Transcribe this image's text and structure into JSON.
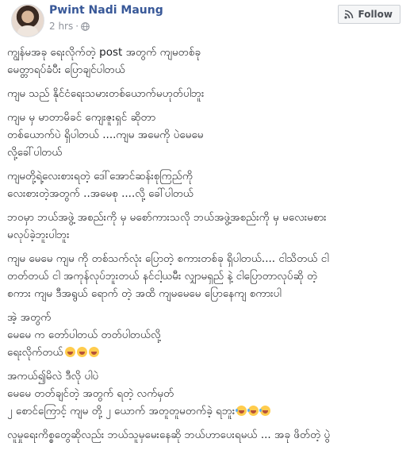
{
  "post": {
    "author": "Pwint Nadi Maung",
    "time": "2 hrs",
    "separator": "·",
    "privacy_icon": "globe-icon",
    "follow_label": "Follow",
    "follow_icon": "rss-icon",
    "paragraphs": [
      {
        "text": "ကျွန်မအခု ရေးလိုက်တဲ့ post အတွက် ကျမတစ်ခု\nမေတ္တာရပ်ခံပီး ပြောချင်ပါတယ်"
      },
      {
        "text": "ကျမ သည် နိုင်ငံရေးသမားတစ်ယောက်မဟုတ်ပါဘူး"
      },
      {
        "text": "ကျမ မှ မာတာမိခင် ကျေးဇူးရှင် ဆိုတာ\nတစ်ယောက်ပဲ ရှိပါတယ် ....ကျမ အမေကို ပဲမေမေ\nလို့ခေါ်ပါတယ်"
      },
      {
        "text": "ကျမတို့ရဲ့လေးစားရတဲ့ ဒေါ်အောင်ဆန်းစုကြည်ကို\nလေးစားတဲ့အတွက် ..အမေစု ....လို့ ခေါ်ပါတယ်"
      },
      {
        "text": "ဘဝမှာ ဘယ်အဖွဲ့ အစည်းကို မှ မစော်ကားသလို ဘယ်အဖွဲ့အစည်းကို မှ မလေးမစား\nမလုပ်ခဲ့ဘူးပါဘူး"
      },
      {
        "text": "ကျမ မေမေ ကျမ ကို တစ်သက်လုံး ပြောတဲ့ စကားတစ်ခု ရှိပါတယ်.... ငါသိတယ် ငါ\nတတ်တယ် ငါ အကုန်လုပ်ဘူးတယ် နင်ငါ့ယမီး လျှာမရှည် နဲ့ ငါပြောတာလုပ်ဆို တဲ့\nစကား ကျမ ဒီအရွယ် ရောက် တဲ့ အထိ ကျမမေမေ ပြောနေကျ စကားပါ"
      },
      {
        "text": "အဲ့ အတွက်\nမေမေ က တော်ပါတယ် တတ်ပါတယ်လို့\nရေးလိုက်တယ်",
        "emojis": 3,
        "emoji_kind": "tongue"
      },
      {
        "text": "အကယ်၍မိလဲ ဒီလို ပါပဲ\nမေမေ တတ်ချင်တဲ့ အတွက် ရတဲ့ လက်မှတ်\n၂ စောင်ကြောင့် ကျမ တို့ ၂ ယောက် အတူတူမတက်ခဲ့ ရဘူး",
        "emojis": 3,
        "emoji_kind": "laugh"
      },
      {
        "text": "လူမှုရေးကိစ္စတွေဆိုလည်း ဘယ်သူမှမေးနေဆို ဘယ်ဟာပေးရမယ် ... အခု ဖိတ်တဲ့ ပွဲ"
      }
    ]
  }
}
